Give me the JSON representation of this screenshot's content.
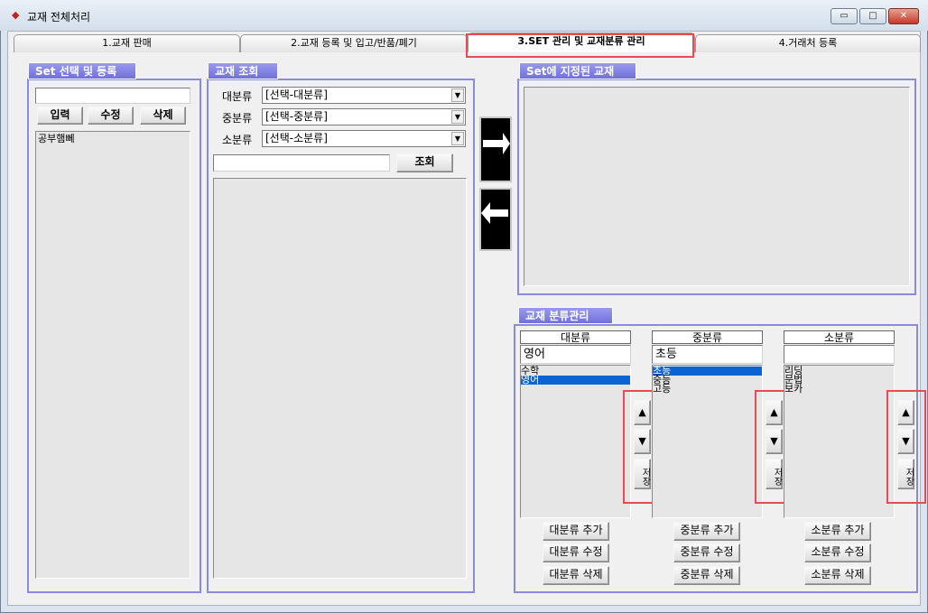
{
  "window": {
    "title": "교재 전체처리",
    "minimize": "▭",
    "maximize": "□",
    "close": "✕"
  },
  "tabs": [
    {
      "label": "1.교재 판매"
    },
    {
      "label": "2.교재 등록 및 입고/반품/폐기"
    },
    {
      "label": "3.SET 관리 및 교재분류 관리"
    },
    {
      "label": "4.거래처 등록"
    }
  ],
  "set_panel": {
    "title": "Set 선택 및 등록",
    "input_value": "",
    "btn_input": "입력",
    "btn_edit": "수정",
    "btn_delete": "삭제",
    "items": [
      "공부햄뻬"
    ]
  },
  "lookup_panel": {
    "title": "교재 조회",
    "large_label": "대분류",
    "large_value": "[선택-대분류]",
    "mid_label": "중분류",
    "mid_value": "[선택-중분류]",
    "small_label": "소분류",
    "small_value": "[선택-소분류]",
    "search_value": "",
    "search_button": "조회"
  },
  "set_books_panel": {
    "title": "Set에 지정된 교재"
  },
  "category_panel": {
    "title": "교재 분류관리",
    "large": {
      "header": "대분류",
      "input": "영어",
      "items": [
        "수학",
        "영어"
      ],
      "add": "대분류 추가",
      "edit": "대분류 수정",
      "delete": "대분류 삭제"
    },
    "mid": {
      "header": "중분류",
      "input": "초등",
      "items": [
        "초등",
        "중등",
        "고등"
      ],
      "add": "중분류 추가",
      "edit": "중분류 수정",
      "delete": "중분류 삭제"
    },
    "small": {
      "header": "소분류",
      "input": "",
      "items": [
        "리딩",
        "문법",
        "보카"
      ],
      "add": "소분류 추가",
      "edit": "소분류 수정",
      "delete": "소분류 삭제"
    },
    "up": "▲",
    "down": "▼",
    "save": "저장"
  }
}
